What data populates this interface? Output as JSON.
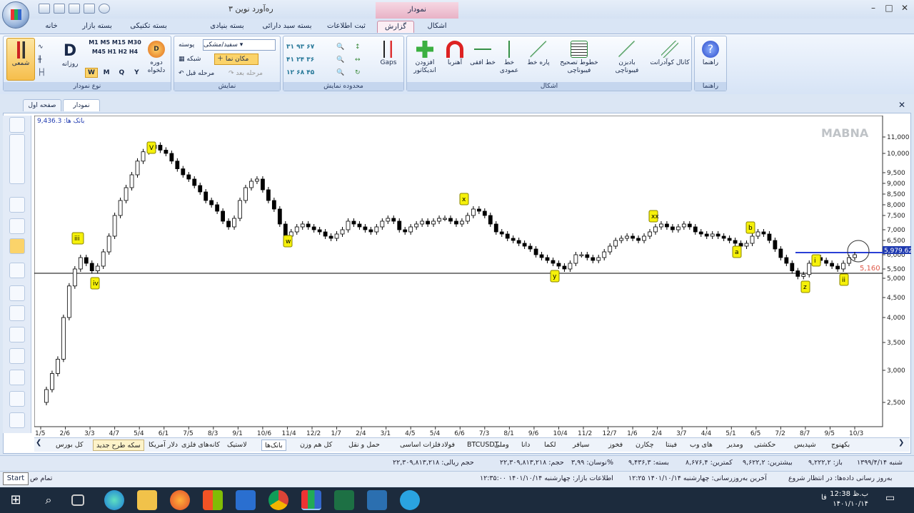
{
  "app": {
    "title": "رەآورد نوین ۳",
    "context_tab": "نمودار"
  },
  "tabs": [
    "اشکال",
    "گزارش",
    "ثبت اطلاعات",
    "بسته سبد دارائی",
    "بسته بنیادی",
    "بسته تکنیکی",
    "بسته بازار",
    "خانه"
  ],
  "ribbon": {
    "help": {
      "label": "راهنما",
      "group": "راهنما"
    },
    "shapes": {
      "group": "اشکال",
      "buttons": [
        "کانال کوآدرانت",
        "بادبزن فیبوناچی",
        "خطوط تصحیح فیبوناچی",
        "پاره خط",
        "خط عمودی",
        "خط افقی",
        "آهنربا",
        "افزودن اندیکاتور"
      ]
    },
    "range": {
      "group": "محدوده نمایش",
      "gaps": "Gaps"
    },
    "display": {
      "group": "نمایش",
      "theme_value": "سفید/مشکی",
      "theme_label": "پوسته",
      "grid": "شبکه",
      "cursor": "مکان نما",
      "next_step": "مرحله بعد",
      "prev_step": "مرحله قبل"
    },
    "chart_type": {
      "group": "نوع نمودار",
      "candle": "شمعی",
      "daily": "روزانه",
      "custom": "دوره دلخواه",
      "periods": [
        "W",
        "M",
        "Q",
        "Y"
      ],
      "minutes": [
        "1",
        "5",
        "15",
        "30",
        "45",
        "1",
        "2",
        "4"
      ]
    }
  },
  "doc_tabs": [
    "نمودار",
    "صفحه اول"
  ],
  "chart": {
    "watermark": "MABNA",
    "top_label": "باتک ها: 9,436.3",
    "price_last": "5,979.62",
    "hline_value": "5,160",
    "y_ticks": [
      "11,000",
      "10,000",
      "9,500",
      "9,000",
      "8,500",
      "8,000",
      "7,500",
      "7,000",
      "6,500",
      "6,000",
      "5,500",
      "5,000",
      "4,500",
      "4,000",
      "3,500",
      "3,000",
      "2,500"
    ],
    "x_ticks": [
      "1/5",
      "2/6",
      "3/3",
      "4/7",
      "5/4",
      "6/1",
      "7/5",
      "8/3",
      "9/1",
      "10/6",
      "11/4",
      "12/2",
      "1/7",
      "2/4",
      "3/1",
      "4/5",
      "5/4",
      "6/6",
      "7/3",
      "8/1",
      "9/6",
      "10/4",
      "11/2",
      "12/7",
      "1/6",
      "2/4",
      "3/7",
      "4/4",
      "5/1",
      "6/5",
      "7/2",
      "8/7",
      "9/5",
      "10/3"
    ],
    "waves": [
      "iii",
      "iv",
      "V",
      "w",
      "x",
      "y",
      "xx",
      "a",
      "b",
      "z",
      "i",
      "ii"
    ]
  },
  "symbols": [
    "بکهنوج",
    "شپدیس",
    "حکشتی",
    "ومدیر",
    "های وب",
    "فینتا",
    "چکارن",
    "فخوز",
    "سیافر",
    "لکما",
    "دانا",
    "وملی",
    "BTCUSDT",
    "فولاد",
    "فلزات اساسی",
    "حمل و نقل",
    "کل هم وزن",
    "بانک‌ها",
    "لاستیک",
    "کانه‌های فلزی",
    "دلار آمریکا",
    "سکه طرح جدید",
    "کل بورس"
  ],
  "status1": [
    "شنبه ۱۳۹۹/۴/۱۴",
    "باز: ۹,۲۲۲,۲",
    "بیشترین: ۹,۶۲۲,۲",
    "کمترین: ۸,۶۷۶,۴",
    "بسته: ۹,۴۳۶,۳",
    "نوسان: ۳,۹۹%",
    "حجم: ۲۲,۳۰۹,۸۱۳,۲۱۸",
    "حجم ریالی: ۲۲,۳۰۹,۸۱۳,۲۱۸"
  ],
  "status2": [
    "به‌روز رسانی داده‌ها: در انتظار شروع",
    "آخرین به‌روزرسانی: چهارشنبه ۱۴۰۱/۱۰/۱۴ ۱۲:۲۵",
    "اطلاعات بازار: چهارشنبه ۱۴۰۱/۱۰/۱۴ ۱۲:۳۵:۰۰",
    "تمام ص"
  ],
  "start_tooltip": "Start",
  "clock": {
    "time": "12:38 ب.ظ",
    "date": "۱۴۰۱/۱۰/۱۴",
    "lang": "فا"
  },
  "colors": {
    "accent": "#2a3fd6",
    "hline": "#000000",
    "label_bg": "#f6f10a",
    "ctx": "#e8b2c6"
  }
}
